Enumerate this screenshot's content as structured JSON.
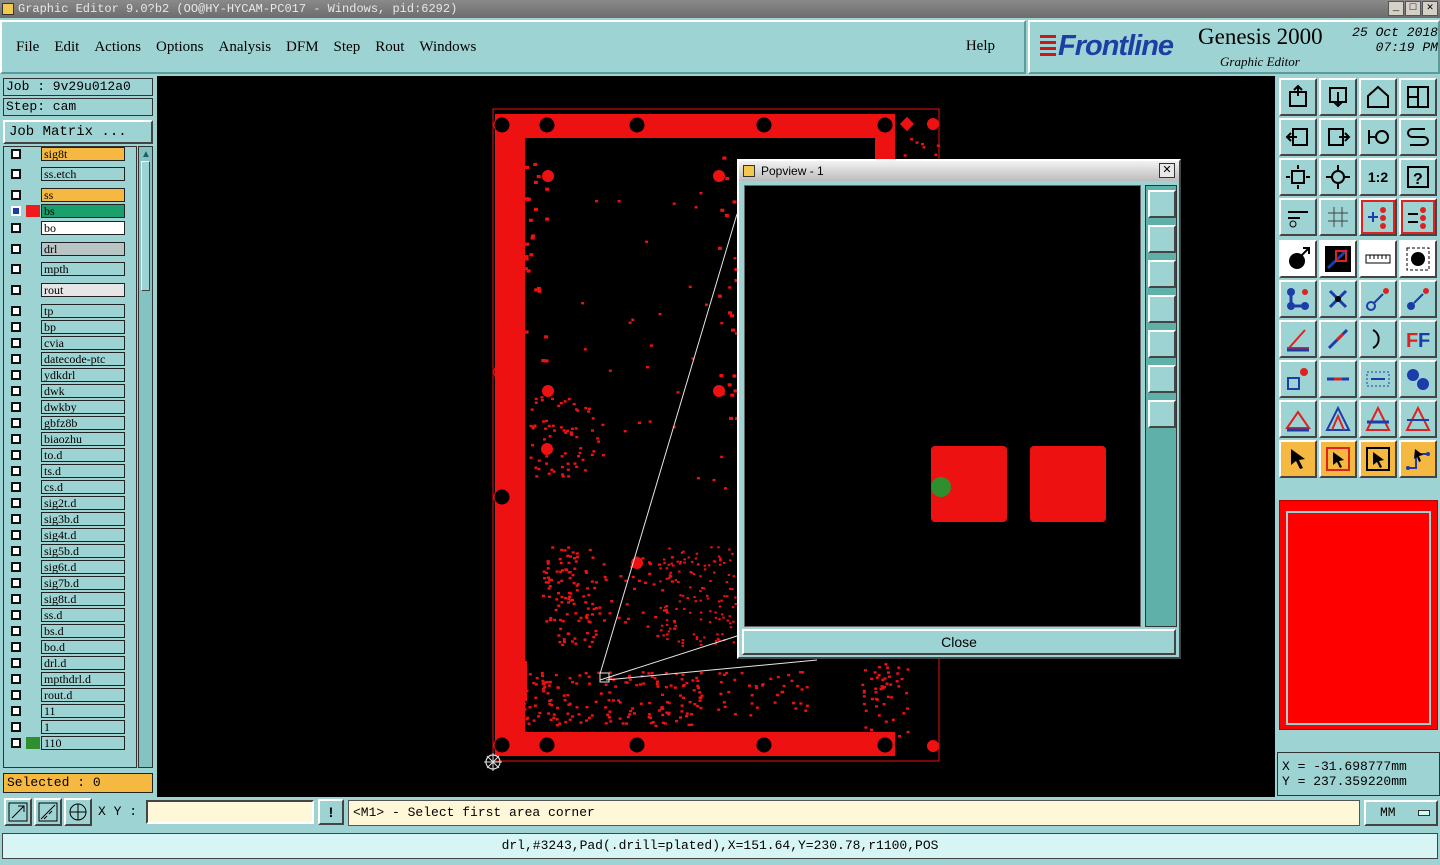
{
  "window": {
    "title": "Graphic Editor 9.0?b2 (OO@HY-HYCAM-PC017 - Windows, pid:6292)"
  },
  "menu": {
    "items": [
      "File",
      "Edit",
      "Actions",
      "Options",
      "Analysis",
      "DFM",
      "Step",
      "Rout",
      "Windows"
    ],
    "help": "Help"
  },
  "brand": {
    "logo": "Frontline",
    "product": "Genesis 2000",
    "subtitle": "Graphic Editor",
    "date": "25 Oct 2018",
    "time": "07:19 PM"
  },
  "job": {
    "job_label": "Job : 9v29u012a0",
    "step_label": "Step: cam",
    "job_matrix_button": "Job Matrix ..."
  },
  "layers": [
    {
      "name": "sig8t",
      "bg": "#f5b840"
    },
    {
      "name": "ss.etch",
      "bg": "#9ed3d3"
    },
    {
      "name": "ss",
      "bg": "#f5b840"
    },
    {
      "name": "bs",
      "bg": "#1aa06c",
      "active": true,
      "swatch": "#ee1c1c"
    },
    {
      "name": "bo",
      "bg": "#ffffff"
    },
    {
      "name": "drl",
      "bg": "#b9c4c4"
    },
    {
      "name": "mpth",
      "bg": "#9ed3d3"
    },
    {
      "name": "rout",
      "bg": "#e6e6e6"
    },
    {
      "name": "tp",
      "bg": "#9ed3d3"
    },
    {
      "name": "bp",
      "bg": "#9ed3d3"
    },
    {
      "name": "cvia",
      "bg": "#9ed3d3"
    },
    {
      "name": "datecode-ptc",
      "bg": "#9ed3d3"
    },
    {
      "name": "ydkdrl",
      "bg": "#9ed3d3"
    },
    {
      "name": "dwk",
      "bg": "#9ed3d3"
    },
    {
      "name": "dwkby",
      "bg": "#9ed3d3"
    },
    {
      "name": "gbfz8b",
      "bg": "#9ed3d3"
    },
    {
      "name": "biaozhu",
      "bg": "#9ed3d3"
    },
    {
      "name": "to.d",
      "bg": "#9ed3d3"
    },
    {
      "name": "ts.d",
      "bg": "#9ed3d3"
    },
    {
      "name": "cs.d",
      "bg": "#9ed3d3"
    },
    {
      "name": "sig2t.d",
      "bg": "#9ed3d3"
    },
    {
      "name": "sig3b.d",
      "bg": "#9ed3d3"
    },
    {
      "name": "sig4t.d",
      "bg": "#9ed3d3"
    },
    {
      "name": "sig5b.d",
      "bg": "#9ed3d3"
    },
    {
      "name": "sig6t.d",
      "bg": "#9ed3d3"
    },
    {
      "name": "sig7b.d",
      "bg": "#9ed3d3"
    },
    {
      "name": "sig8t.d",
      "bg": "#9ed3d3"
    },
    {
      "name": "ss.d",
      "bg": "#9ed3d3"
    },
    {
      "name": "bs.d",
      "bg": "#9ed3d3"
    },
    {
      "name": "bo.d",
      "bg": "#9ed3d3"
    },
    {
      "name": "drl.d",
      "bg": "#9ed3d3"
    },
    {
      "name": "mpthdrl.d",
      "bg": "#9ed3d3"
    },
    {
      "name": "rout.d",
      "bg": "#9ed3d3"
    },
    {
      "name": "11",
      "bg": "#9ed3d3"
    },
    {
      "name": "1",
      "bg": "#9ed3d3"
    },
    {
      "name": "110",
      "bg": "#9ed3d3",
      "swatch": "#2f8f2f"
    }
  ],
  "selected": "Selected : 0",
  "popview": {
    "title": "Popview - 1",
    "close_button": "Close"
  },
  "coords": {
    "x": "X = -31.698777mm",
    "y": "Y = 237.359220mm"
  },
  "input": {
    "xy_label": "X Y :",
    "xy_value": "",
    "prompt": "<M1> - Select first area corner",
    "units": "MM",
    "excl": "!"
  },
  "status": "drl,#3243,Pad(.drill=plated),X=151.64,Y=230.78,r1100,POS",
  "colors": {
    "accent": "#9ed3d3",
    "pcb": "#ee1111",
    "highlight": "#f5b840"
  }
}
